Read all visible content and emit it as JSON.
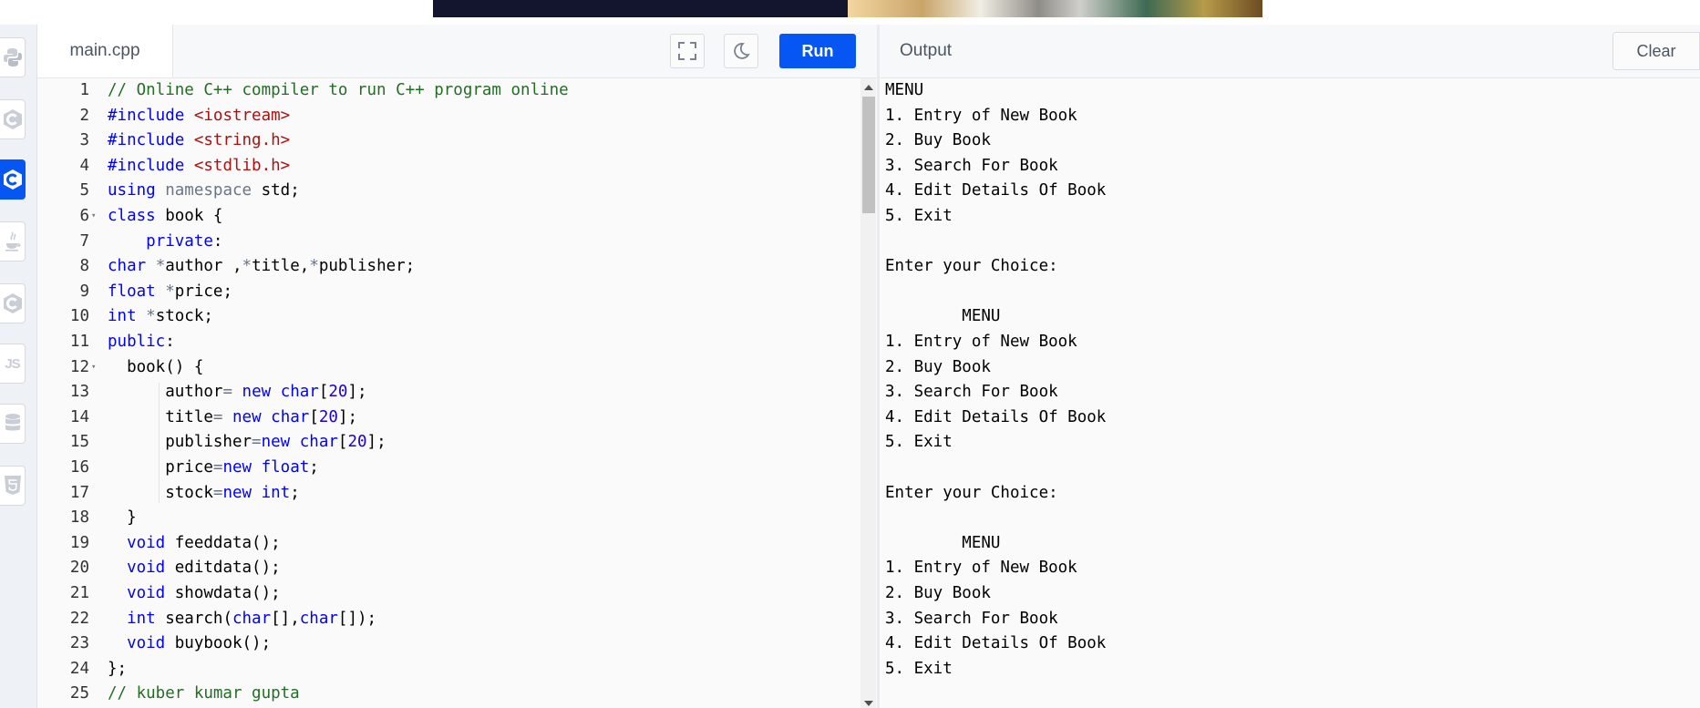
{
  "editor": {
    "tab_label": "main.cpp",
    "run_label": "Run",
    "lines": [
      [
        [
          "comment",
          "// Online C++ compiler to run C++ program online"
        ]
      ],
      [
        [
          "kw",
          "#include"
        ],
        [
          "plain",
          " "
        ],
        [
          "str",
          "<iostream>"
        ]
      ],
      [
        [
          "kw",
          "#include"
        ],
        [
          "plain",
          " "
        ],
        [
          "str",
          "<string.h>"
        ]
      ],
      [
        [
          "kw",
          "#include"
        ],
        [
          "plain",
          " "
        ],
        [
          "str",
          "<stdlib.h>"
        ]
      ],
      [
        [
          "kw",
          "using"
        ],
        [
          "plain",
          " "
        ],
        [
          "op",
          "namespace"
        ],
        [
          "plain",
          " std;"
        ]
      ],
      [
        [
          "kw",
          "class"
        ],
        [
          "plain",
          " book {"
        ]
      ],
      [
        [
          "plain",
          "    "
        ],
        [
          "kw",
          "private"
        ],
        [
          "plain",
          ":"
        ]
      ],
      [
        [
          "kw",
          "char"
        ],
        [
          "plain",
          " "
        ],
        [
          "op",
          "*"
        ],
        [
          "plain",
          "author ,"
        ],
        [
          "op",
          "*"
        ],
        [
          "plain",
          "title,"
        ],
        [
          "op",
          "*"
        ],
        [
          "plain",
          "publisher;"
        ]
      ],
      [
        [
          "kw",
          "float"
        ],
        [
          "plain",
          " "
        ],
        [
          "op",
          "*"
        ],
        [
          "plain",
          "price;"
        ]
      ],
      [
        [
          "kw",
          "int"
        ],
        [
          "plain",
          " "
        ],
        [
          "op",
          "*"
        ],
        [
          "plain",
          "stock;"
        ]
      ],
      [
        [
          "kw",
          "public"
        ],
        [
          "plain",
          ":"
        ]
      ],
      [
        [
          "plain",
          "  book() {"
        ]
      ],
      [
        [
          "plain",
          "      author"
        ],
        [
          "op",
          "="
        ],
        [
          "plain",
          " "
        ],
        [
          "kw",
          "new"
        ],
        [
          "plain",
          " "
        ],
        [
          "kw",
          "char"
        ],
        [
          "plain",
          "["
        ],
        [
          "num",
          "20"
        ],
        [
          "plain",
          "];"
        ]
      ],
      [
        [
          "plain",
          "      title"
        ],
        [
          "op",
          "="
        ],
        [
          "plain",
          " "
        ],
        [
          "kw",
          "new"
        ],
        [
          "plain",
          " "
        ],
        [
          "kw",
          "char"
        ],
        [
          "plain",
          "["
        ],
        [
          "num",
          "20"
        ],
        [
          "plain",
          "];"
        ]
      ],
      [
        [
          "plain",
          "      publisher"
        ],
        [
          "op",
          "="
        ],
        [
          "kw",
          "new"
        ],
        [
          "plain",
          " "
        ],
        [
          "kw",
          "char"
        ],
        [
          "plain",
          "["
        ],
        [
          "num",
          "20"
        ],
        [
          "plain",
          "];"
        ]
      ],
      [
        [
          "plain",
          "      price"
        ],
        [
          "op",
          "="
        ],
        [
          "kw",
          "new"
        ],
        [
          "plain",
          " "
        ],
        [
          "kw",
          "float"
        ],
        [
          "plain",
          ";"
        ]
      ],
      [
        [
          "plain",
          "      stock"
        ],
        [
          "op",
          "="
        ],
        [
          "kw",
          "new"
        ],
        [
          "plain",
          " "
        ],
        [
          "kw",
          "int"
        ],
        [
          "plain",
          ";"
        ]
      ],
      [
        [
          "plain",
          "  }"
        ]
      ],
      [
        [
          "plain",
          "  "
        ],
        [
          "kw",
          "void"
        ],
        [
          "plain",
          " feeddata();"
        ]
      ],
      [
        [
          "plain",
          "  "
        ],
        [
          "kw",
          "void"
        ],
        [
          "plain",
          " editdata();"
        ]
      ],
      [
        [
          "plain",
          "  "
        ],
        [
          "kw",
          "void"
        ],
        [
          "plain",
          " showdata();"
        ]
      ],
      [
        [
          "plain",
          "  "
        ],
        [
          "kw",
          "int"
        ],
        [
          "plain",
          " search("
        ],
        [
          "kw",
          "char"
        ],
        [
          "plain",
          "[],"
        ],
        [
          "kw",
          "char"
        ],
        [
          "plain",
          "[]);"
        ]
      ],
      [
        [
          "plain",
          "  "
        ],
        [
          "kw",
          "void"
        ],
        [
          "plain",
          " buybook();"
        ]
      ],
      [
        [
          "plain",
          "};"
        ]
      ],
      [
        [
          "comment",
          "// kuber kumar gupta"
        ]
      ]
    ]
  },
  "output": {
    "title": "Output",
    "clear_label": "Clear",
    "lines": [
      "MENU",
      "1. Entry of New Book",
      "2. Buy Book",
      "3. Search For Book",
      "4. Edit Details Of Book",
      "5. Exit",
      "",
      "Enter your Choice:",
      "",
      "\t\tMENU",
      "1. Entry of New Book",
      "2. Buy Book",
      "3. Search For Book",
      "4. Edit Details Of Book",
      "5. Exit",
      "",
      "Enter your Choice:",
      "",
      "\t\tMENU",
      "1. Entry of New Book",
      "2. Buy Book",
      "3. Search For Book",
      "4. Edit Details Of Book",
      "5. Exit"
    ]
  },
  "languages": [
    {
      "name": "python-icon",
      "active": false
    },
    {
      "name": "c-icon",
      "active": false
    },
    {
      "name": "cpp-icon",
      "active": true
    },
    {
      "name": "java-icon",
      "active": false
    },
    {
      "name": "csharp-icon",
      "active": false
    },
    {
      "name": "javascript-icon",
      "active": false,
      "text": "JS"
    },
    {
      "name": "sql-database-icon",
      "active": false
    },
    {
      "name": "html5-icon",
      "active": false
    }
  ],
  "colors": {
    "accent": "#0556f3",
    "keyword": "#0000ff",
    "string": "#aa1111",
    "comment": "#236e24",
    "number": "#1c00cf"
  }
}
